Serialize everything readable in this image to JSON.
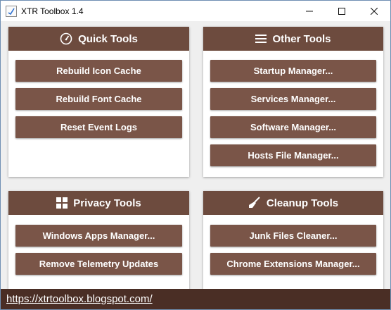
{
  "window": {
    "title": "XTR Toolbox 1.4"
  },
  "panels": {
    "quick": {
      "title": "Quick Tools",
      "icon": "speedometer-icon",
      "buttons": [
        "Rebuild Icon Cache",
        "Rebuild Font Cache",
        "Reset Event Logs"
      ]
    },
    "other": {
      "title": "Other Tools",
      "icon": "menu-icon",
      "buttons": [
        "Startup Manager...",
        "Services Manager...",
        "Software Manager...",
        "Hosts File Manager..."
      ]
    },
    "privacy": {
      "title": "Privacy Tools",
      "icon": "windows-logo-icon",
      "buttons": [
        "Windows Apps Manager...",
        "Remove Telemetry Updates"
      ]
    },
    "cleanup": {
      "title": "Cleanup Tools",
      "icon": "broom-icon",
      "buttons": [
        "Junk Files Cleaner...",
        "Chrome Extensions Manager..."
      ]
    }
  },
  "footer": {
    "link": "https://xtrtoolbox.blogspot.com/"
  },
  "colors": {
    "header": "#6d4b3e",
    "button": "#7a5548",
    "footer": "#4a2e25"
  }
}
